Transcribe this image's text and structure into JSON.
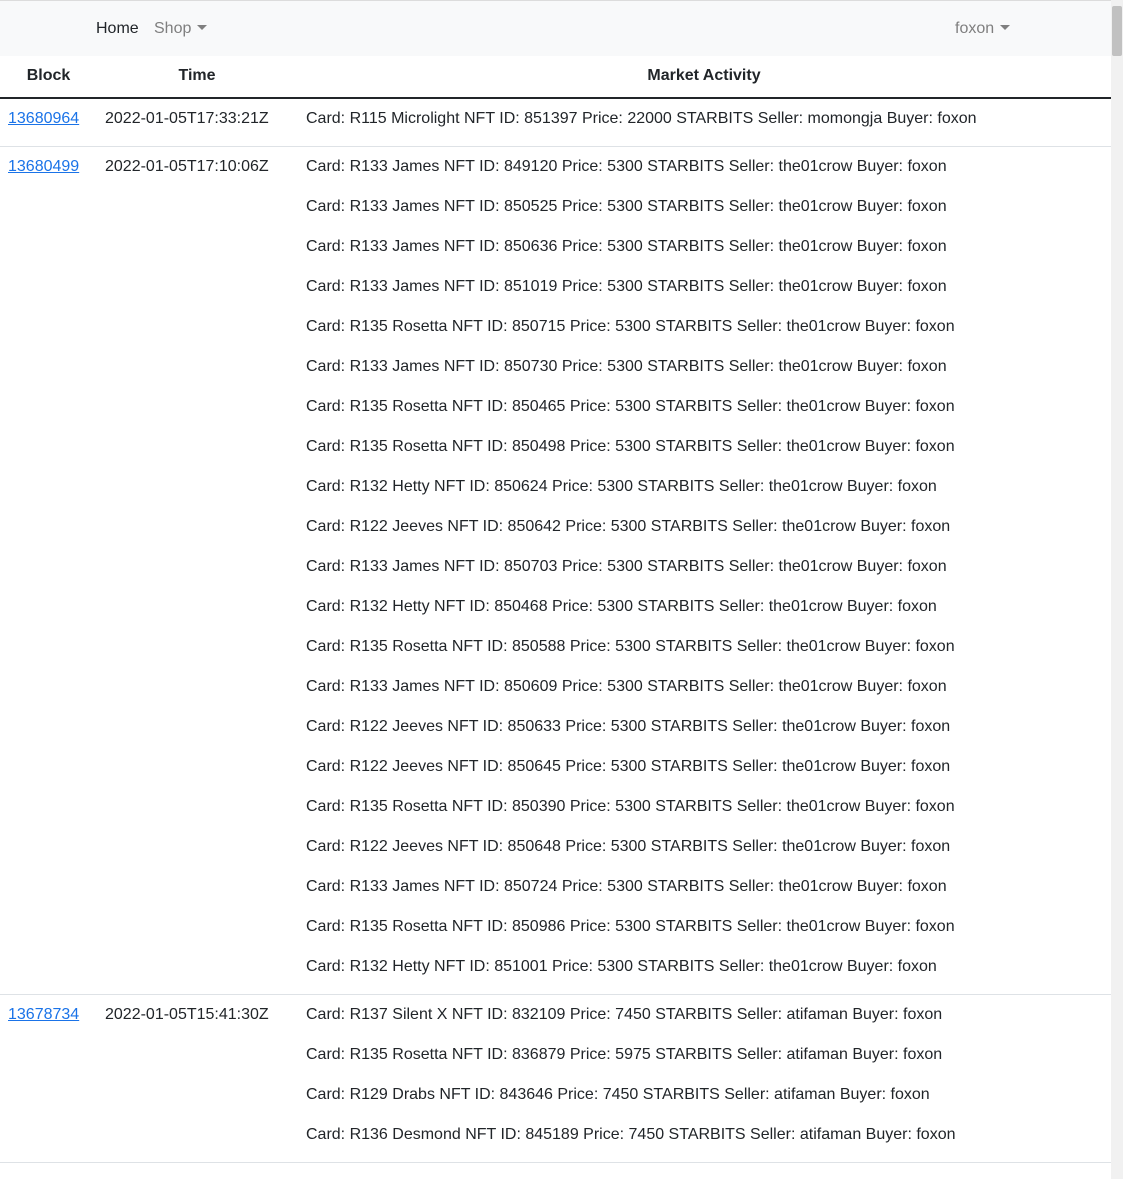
{
  "nav": {
    "home": "Home",
    "shop": "Shop",
    "user": "foxon"
  },
  "table": {
    "headers": {
      "block": "Block",
      "time": "Time",
      "market": "Market Activity"
    },
    "rows": [
      {
        "block": "13680964",
        "time": "2022-01-05T17:33:21Z",
        "activity": [
          "Card: R115 Microlight NFT ID: 851397 Price: 22000 STARBITS Seller: momongja Buyer: foxon"
        ]
      },
      {
        "block": "13680499",
        "time": "2022-01-05T17:10:06Z",
        "activity": [
          "Card: R133 James NFT ID: 849120 Price: 5300 STARBITS Seller: the01crow Buyer: foxon",
          "Card: R133 James NFT ID: 850525 Price: 5300 STARBITS Seller: the01crow Buyer: foxon",
          "Card: R133 James NFT ID: 850636 Price: 5300 STARBITS Seller: the01crow Buyer: foxon",
          "Card: R133 James NFT ID: 851019 Price: 5300 STARBITS Seller: the01crow Buyer: foxon",
          "Card: R135 Rosetta NFT ID: 850715 Price: 5300 STARBITS Seller: the01crow Buyer: foxon",
          "Card: R133 James NFT ID: 850730 Price: 5300 STARBITS Seller: the01crow Buyer: foxon",
          "Card: R135 Rosetta NFT ID: 850465 Price: 5300 STARBITS Seller: the01crow Buyer: foxon",
          "Card: R135 Rosetta NFT ID: 850498 Price: 5300 STARBITS Seller: the01crow Buyer: foxon",
          "Card: R132 Hetty NFT ID: 850624 Price: 5300 STARBITS Seller: the01crow Buyer: foxon",
          "Card: R122 Jeeves NFT ID: 850642 Price: 5300 STARBITS Seller: the01crow Buyer: foxon",
          "Card: R133 James NFT ID: 850703 Price: 5300 STARBITS Seller: the01crow Buyer: foxon",
          "Card: R132 Hetty NFT ID: 850468 Price: 5300 STARBITS Seller: the01crow Buyer: foxon",
          "Card: R135 Rosetta NFT ID: 850588 Price: 5300 STARBITS Seller: the01crow Buyer: foxon",
          "Card: R133 James NFT ID: 850609 Price: 5300 STARBITS Seller: the01crow Buyer: foxon",
          "Card: R122 Jeeves NFT ID: 850633 Price: 5300 STARBITS Seller: the01crow Buyer: foxon",
          "Card: R122 Jeeves NFT ID: 850645 Price: 5300 STARBITS Seller: the01crow Buyer: foxon",
          "Card: R135 Rosetta NFT ID: 850390 Price: 5300 STARBITS Seller: the01crow Buyer: foxon",
          "Card: R122 Jeeves NFT ID: 850648 Price: 5300 STARBITS Seller: the01crow Buyer: foxon",
          "Card: R133 James NFT ID: 850724 Price: 5300 STARBITS Seller: the01crow Buyer: foxon",
          "Card: R135 Rosetta NFT ID: 850986 Price: 5300 STARBITS Seller: the01crow Buyer: foxon",
          "Card: R132 Hetty NFT ID: 851001 Price: 5300 STARBITS Seller: the01crow Buyer: foxon"
        ]
      },
      {
        "block": "13678734",
        "time": "2022-01-05T15:41:30Z",
        "activity": [
          "Card: R137 Silent X NFT ID: 832109 Price: 7450 STARBITS Seller: atifaman Buyer: foxon",
          "Card: R135 Rosetta NFT ID: 836879 Price: 5975 STARBITS Seller: atifaman Buyer: foxon",
          "Card: R129 Drabs NFT ID: 843646 Price: 7450 STARBITS Seller: atifaman Buyer: foxon",
          "Card: R136 Desmond NFT ID: 845189 Price: 7450 STARBITS Seller: atifaman Buyer: foxon"
        ]
      }
    ]
  }
}
